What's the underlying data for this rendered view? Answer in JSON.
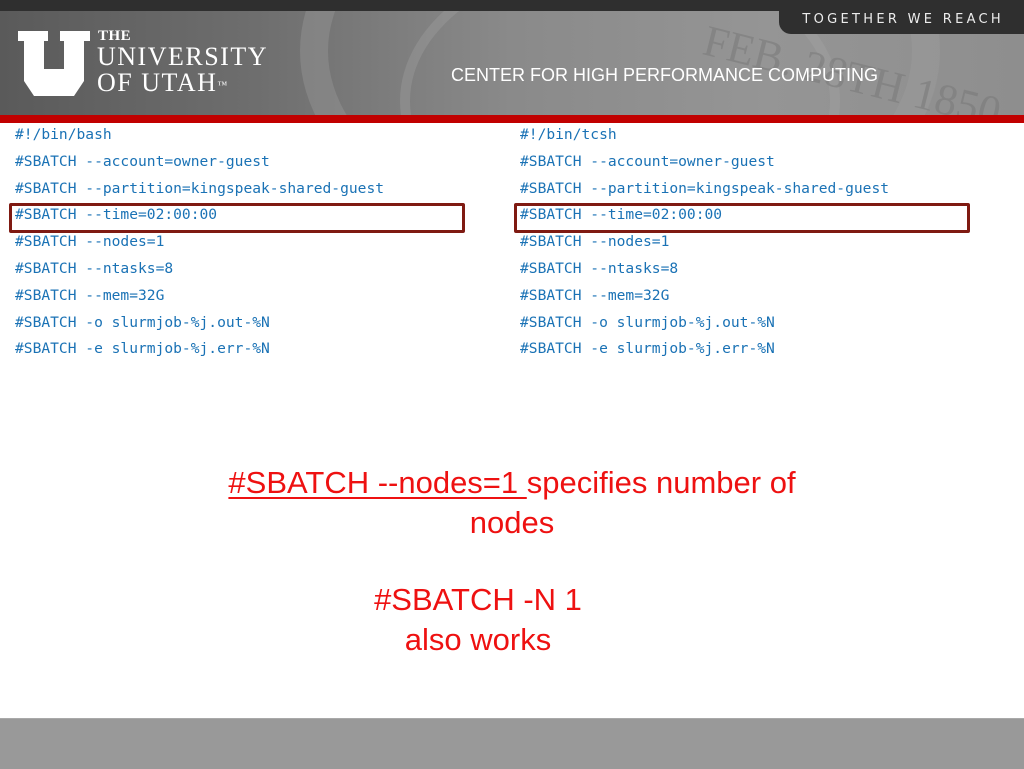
{
  "header": {
    "tagline": "TOGETHER WE REACH",
    "logo": {
      "the": "THE",
      "university": "UNIVERSITY",
      "of_utah": "OF UTAH",
      "trademark": "™"
    },
    "seal_text": "FEB. 28TH 1850",
    "center_title": "CENTER FOR HIGH PERFORMANCE COMPUTING"
  },
  "colors": {
    "code_text": "#1a72b5",
    "highlight_box": "#7f1a12",
    "note_text": "#ee1111",
    "red_bar": "#c10000"
  },
  "scripts": {
    "left": {
      "lines": [
        "#!/bin/bash",
        "#SBATCH --account=owner-guest",
        "#SBATCH --partition=kingspeak-shared-guest",
        "#SBATCH --time=02:00:00",
        "#SBATCH --nodes=1",
        "#SBATCH --ntasks=8",
        "#SBATCH --mem=32G",
        "#SBATCH -o slurmjob-%j.out-%N",
        "#SBATCH -e slurmjob-%j.err-%N"
      ],
      "highlighted_line": "#SBATCH --time=02:00:00"
    },
    "right": {
      "lines": [
        "#!/bin/tcsh",
        "#SBATCH --account=owner-guest",
        "#SBATCH --partition=kingspeak-shared-guest",
        "#SBATCH --time=02:00:00",
        "#SBATCH --nodes=1",
        "#SBATCH --ntasks=8",
        "#SBATCH --mem=32G",
        "#SBATCH -o slurmjob-%j.out-%N",
        "#SBATCH -e slurmjob-%j.err-%N"
      ],
      "highlighted_line": "#SBATCH --time=02:00:00"
    }
  },
  "notes": {
    "note1_underlined": "#SBATCH --nodes=1 ",
    "note1_rest": " specifies number of",
    "note1_line2": "nodes",
    "note2_line1": "#SBATCH -N 1",
    "note2_line2": "also works"
  }
}
